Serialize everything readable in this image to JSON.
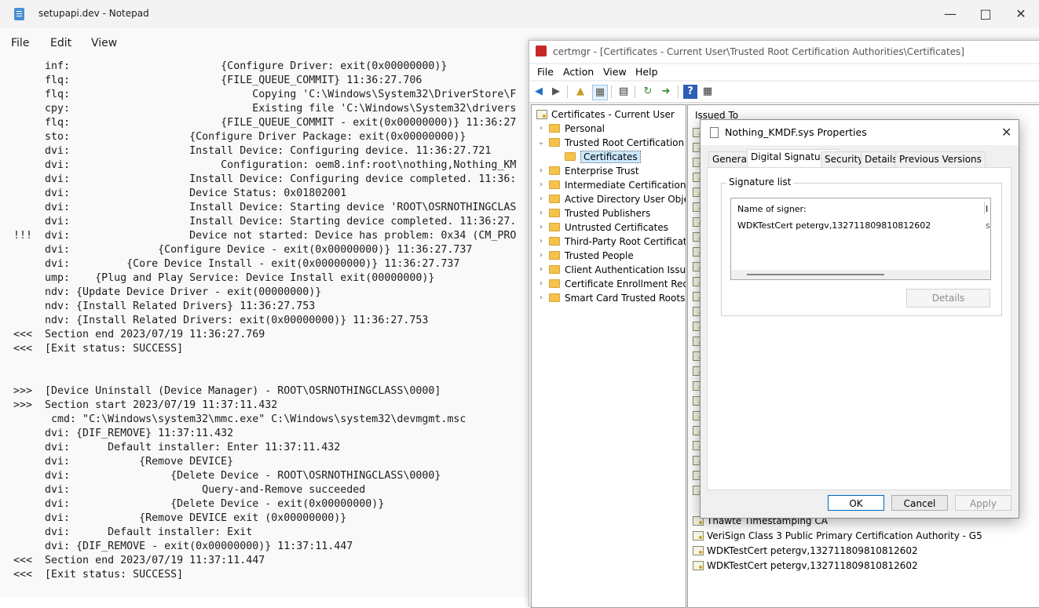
{
  "notepad": {
    "title": "setupapi.dev - Notepad",
    "menu": [
      "File",
      "Edit",
      "View"
    ],
    "lines": [
      "     inf:                        {Configure Driver: exit(0x00000000)}",
      "     flq:                        {FILE_QUEUE_COMMIT} 11:36:27.706",
      "     flq:                             Copying 'C:\\Windows\\System32\\DriverStore\\F",
      "     cpy:                             Existing file 'C:\\Windows\\System32\\drivers",
      "     flq:                        {FILE_QUEUE_COMMIT - exit(0x00000000)} 11:36:27",
      "     sto:                   {Configure Driver Package: exit(0x00000000)}",
      "     dvi:                   Install Device: Configuring device. 11:36:27.721",
      "     dvi:                        Configuration: oem8.inf:root\\nothing,Nothing_KM",
      "     dvi:                   Install Device: Configuring device completed. 11:36:",
      "     dvi:                   Device Status: 0x01802001",
      "     dvi:                   Install Device: Starting device 'ROOT\\OSRNOTHINGCLAS",
      "     dvi:                   Install Device: Starting device completed. 11:36:27.",
      "!!!  dvi:                   Device not started: Device has problem: 0x34 (CM_PRO",
      "     dvi:              {Configure Device - exit(0x00000000)} 11:36:27.737",
      "     dvi:         {Core Device Install - exit(0x00000000)} 11:36:27.737",
      "     ump:    {Plug and Play Service: Device Install exit(00000000)}",
      "     ndv: {Update Device Driver - exit(00000000)}",
      "     ndv: {Install Related Drivers} 11:36:27.753",
      "     ndv: {Install Related Drivers: exit(0x00000000)} 11:36:27.753",
      "<<<  Section end 2023/07/19 11:36:27.769",
      "<<<  [Exit status: SUCCESS]",
      "",
      "",
      ">>>  [Device Uninstall (Device Manager) - ROOT\\OSRNOTHINGCLASS\\0000]",
      ">>>  Section start 2023/07/19 11:37:11.432",
      "      cmd: \"C:\\Windows\\system32\\mmc.exe\" C:\\Windows\\system32\\devmgmt.msc",
      "     dvi: {DIF_REMOVE} 11:37:11.432",
      "     dvi:      Default installer: Enter 11:37:11.432",
      "     dvi:           {Remove DEVICE}",
      "     dvi:                {Delete Device - ROOT\\OSRNOTHINGCLASS\\0000}",
      "     dvi:                     Query-and-Remove succeeded",
      "     dvi:                {Delete Device - exit(0x00000000)}",
      "     dvi:           {Remove DEVICE exit (0x00000000)}",
      "     dvi:      Default installer: Exit",
      "     dvi: {DIF_REMOVE - exit(0x00000000)} 11:37:11.447",
      "<<<  Section end 2023/07/19 11:37:11.447",
      "<<<  [Exit status: SUCCESS]"
    ]
  },
  "certmgr": {
    "title": "certmgr - [Certificates - Current User\\Trusted Root Certification Authorities\\Certificates]",
    "menu": [
      "File",
      "Action",
      "View",
      "Help"
    ],
    "tree": {
      "root": "Certificates - Current User",
      "items": [
        {
          "label": "Personal",
          "expanded": false
        },
        {
          "label": "Trusted Root Certification Au",
          "expanded": true
        },
        {
          "label": "Certificates",
          "selected": true
        },
        {
          "label": "Enterprise Trust",
          "expanded": false
        },
        {
          "label": "Intermediate Certification Au",
          "expanded": false
        },
        {
          "label": "Active Directory User Object",
          "expanded": false
        },
        {
          "label": "Trusted Publishers",
          "expanded": false
        },
        {
          "label": "Untrusted Certificates",
          "expanded": false
        },
        {
          "label": "Third-Party Root Certification",
          "expanded": false
        },
        {
          "label": "Trusted People",
          "expanded": false
        },
        {
          "label": "Client Authentication Issuers",
          "expanded": false
        },
        {
          "label": "Certificate Enrollment Reques",
          "expanded": false
        },
        {
          "label": "Smart Card Trusted Roots",
          "expanded": false
        }
      ]
    },
    "list": {
      "header": "Issued To",
      "visible_rows": [
        "Thawte Timestamping CA",
        "VeriSign Class 3 Public Primary Certification Authority - G5",
        "WDKTestCert petergv,132711809810812602",
        "WDKTestCert petergv,132711809810812602"
      ]
    }
  },
  "dialog": {
    "title": "Nothing_KMDF.sys Properties",
    "close": "✕",
    "tabs": [
      "General",
      "Digital Signatures",
      "Security",
      "Details",
      "Previous Versions"
    ],
    "active_tab": "Digital Signatures",
    "signature_list_label": "Signature list",
    "column_header": "Name of signer:",
    "column_header_2": "I",
    "signer": "WDKTestCert petergv,132711809810812602",
    "signer_col2": "s",
    "details_button": "Details",
    "ok": "OK",
    "cancel": "Cancel",
    "apply": "Apply"
  },
  "colors": {
    "ok_border": "#0067c0",
    "tree_selection": "#cce8ff",
    "folder": "#f5c34b"
  }
}
